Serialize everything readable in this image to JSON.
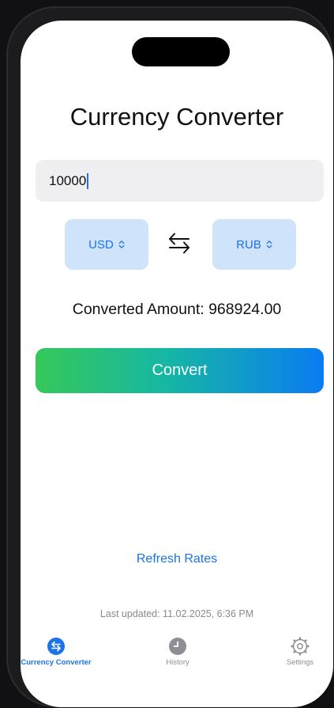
{
  "app": {
    "title": "Currency Converter"
  },
  "amount_input": {
    "value": "10000"
  },
  "currency": {
    "from": "USD",
    "to": "RUB"
  },
  "result": {
    "text": "Converted Amount: 968924.00"
  },
  "actions": {
    "convert_label": "Convert",
    "refresh_label": "Refresh Rates"
  },
  "status": {
    "last_updated": "Last updated: 11.02.2025, 6:36 PM"
  },
  "tabbar": {
    "items": [
      {
        "label": "Currency Converter",
        "icon": "swap-arrows-icon",
        "active": true
      },
      {
        "label": "History",
        "icon": "clock-icon",
        "active": false
      },
      {
        "label": "Settings",
        "icon": "gear-icon",
        "active": false
      }
    ]
  },
  "colors": {
    "accent": "#1a73e8",
    "gradient_start": "#36c85a",
    "gradient_end": "#0a7cf3",
    "currency_button_bg": "#cfe3fb"
  }
}
